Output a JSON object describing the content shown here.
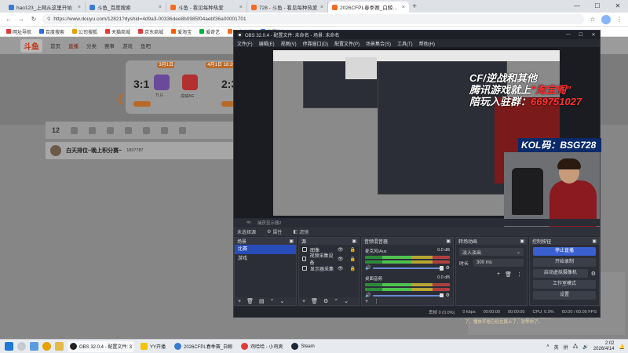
{
  "browser": {
    "tabs": [
      {
        "label": "hao123_上网从这里开始",
        "active": false
      },
      {
        "label": "斗鱼_百度搜索",
        "active": false
      },
      {
        "label": "斗鱼 - 看见每种热爱",
        "active": false
      },
      {
        "label": "728 - 斗鱼 - 看见每种热爱",
        "active": false
      },
      {
        "label": "2026CFPL春季赛_白鲸直播_白鲸A...",
        "active": true
      }
    ],
    "new_tab": "+",
    "url": "https://www.douyu.com/12821?dyshid=4d9a3-00336dee8b0985f04aebf36a00001701",
    "bookmarks": [
      "网址导航",
      "百度搜索",
      "公司搜狐",
      "天猫商城",
      "京东商城",
      "爱淘宝",
      "爱奇艺",
      "斗鱼直播",
      "携程旅行"
    ]
  },
  "douyu": {
    "logo": "斗鱼",
    "nav": [
      "首页",
      "直播",
      "分类",
      "赛事",
      "游戏",
      "鱼吧"
    ],
    "matches": [
      {
        "date": "3月1日 18:20",
        "score": "3:1",
        "team": "TLG"
      },
      {
        "date": "4月1日 18:20",
        "score": "2:3",
        "team": "戎威AG"
      }
    ],
    "toolbar_count": "12",
    "streamer": {
      "title": "白天排位~晚上积分赛~",
      "room": "1837787"
    },
    "chat": "我，我不在意，我没有再看看，已经开始直播了，播放开始已经在路上了，就等你了。"
  },
  "obs": {
    "title": "OBS 32.0.4 - 配置文件: 未命名 - 场景: 未命名",
    "menu": [
      "文件(F)",
      "编辑(E)",
      "视图(V)",
      "停靠窗口(D)",
      "配置文件(P)",
      "场景集合(S)",
      "工具(T)",
      "帮助(H)"
    ],
    "preview_overlay": {
      "line1": "CF/逆战和其他",
      "line2a": "腾讯游戏就上",
      "line2b": "\"淘宝阁\"",
      "line3a": "陪玩入驻群：",
      "line3b": "669751027",
      "kol": "KOL码：BSG728"
    },
    "source_bar": [
      "4x",
      "捕获显示器2"
    ],
    "selection_label": "未选择源",
    "properties_label": "属性",
    "filters_label": "滤镜",
    "docks": {
      "scenes": {
        "title": "场景",
        "items": [
          "比赛",
          "游戏"
        ],
        "selected": 0
      },
      "sources": {
        "title": "源",
        "items": [
          "图像",
          "视频采集设备",
          "显示器采集"
        ]
      },
      "mixer": {
        "title": "音频混音器",
        "channels": [
          {
            "name": "麦克风/Aux",
            "db": "0.0 dB"
          },
          {
            "name": "桌面音频",
            "db": "0.0 dB"
          }
        ]
      },
      "transitions": {
        "title": "转场动画",
        "type": "淡入淡出",
        "duration_label": "时长",
        "duration": "300 ms"
      },
      "controls": {
        "title": "控制按钮",
        "buttons": [
          "停止直播",
          "开始录制",
          "启动虚拟摄像机",
          "工作室模式",
          "设置"
        ]
      }
    },
    "status": [
      "丢帧 0 (0.0%)",
      "0 kbps",
      "00:00:00",
      "00:00:00",
      "CPU: 0.9%",
      "60.00 / 60.00 FPS"
    ]
  },
  "taskbar": {
    "apps": [
      {
        "label": "OBS 32.0.4 - 配置文件: 3"
      },
      {
        "label": "YY开播"
      },
      {
        "label": "2026CFPL春季赛_白鲸"
      },
      {
        "label": "鸡哈哈 - 小鸡爽"
      },
      {
        "label": "Steam"
      }
    ],
    "tray_lang": "英",
    "tray_pinyin": "拼",
    "time": "2:02",
    "date": "2026/4/14"
  },
  "colors": {
    "obs_bg": "#272a33",
    "accent": "#3a5fcf",
    "douyu_orange": "#b86a2a",
    "overlay_yellow": "#f5d000",
    "overlay_red": "#ff3030"
  }
}
